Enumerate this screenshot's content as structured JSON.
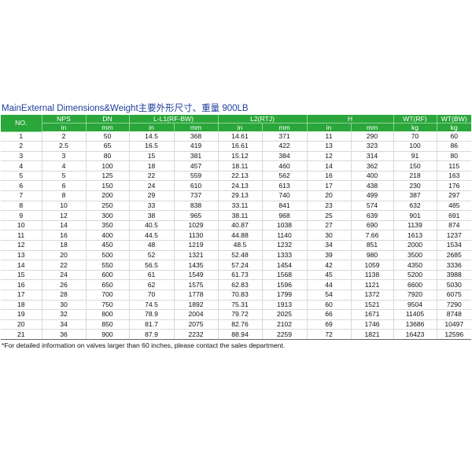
{
  "title": "MainExternal Dimensions&Weight主要外形尺寸、重量   900LB",
  "header": {
    "no": "NO.",
    "nps": "NPS",
    "dn": "DN",
    "l_rf_bw": "L-L1(RF-BW)",
    "l2_rtj": "L2(RTJ)",
    "h": "H",
    "wt_rf": "WT(RF)",
    "wt_bw": "WT(BW)",
    "units": [
      "in",
      "mm",
      "in",
      "mm",
      "in",
      "mm",
      "in",
      "mm",
      "kg",
      "kg"
    ]
  },
  "rows": [
    [
      "1",
      "2",
      "50",
      "14.5",
      "368",
      "14.61",
      "371",
      "11",
      "290",
      "70",
      "60"
    ],
    [
      "2",
      "2.5",
      "65",
      "16.5",
      "419",
      "16.61",
      "422",
      "13",
      "323",
      "100",
      "86"
    ],
    [
      "3",
      "3",
      "80",
      "15",
      "381",
      "15.12",
      "384",
      "12",
      "314",
      "91",
      "80"
    ],
    [
      "4",
      "4",
      "100",
      "18",
      "457",
      "18.11",
      "460",
      "14",
      "362",
      "150",
      "115"
    ],
    [
      "5",
      "5",
      "125",
      "22",
      "559",
      "22.13",
      "562",
      "16",
      "400",
      "218",
      "163"
    ],
    [
      "6",
      "6",
      "150",
      "24",
      "610",
      "24.13",
      "613",
      "17",
      "438",
      "230",
      "176"
    ],
    [
      "7",
      "8",
      "200",
      "29",
      "737",
      "29.13",
      "740",
      "20",
      "499",
      "387",
      "297"
    ],
    [
      "8",
      "10",
      "250",
      "33",
      "838",
      "33.11",
      "841",
      "23",
      "574",
      "632",
      "485"
    ],
    [
      "9",
      "12",
      "300",
      "38",
      "965",
      "38.11",
      "968",
      "25",
      "639",
      "901",
      "691"
    ],
    [
      "10",
      "14",
      "350",
      "40.5",
      "1029",
      "40.87",
      "1038",
      "27",
      "690",
      "1139",
      "874"
    ],
    [
      "11",
      "16",
      "400",
      "44.5",
      "1130",
      "44.88",
      "1140",
      "30",
      "7.66",
      "1613",
      "1237"
    ],
    [
      "12",
      "18",
      "450",
      "48",
      "1219",
      "48.5",
      "1232",
      "34",
      "851",
      "2000",
      "1534"
    ],
    [
      "13",
      "20",
      "500",
      "52",
      "1321",
      "52.48",
      "1333",
      "39",
      "980",
      "3500",
      "2685"
    ],
    [
      "14",
      "22",
      "550",
      "56.5",
      "1435",
      "57.24",
      "1454",
      "42",
      "1059",
      "4350",
      "3336"
    ],
    [
      "15",
      "24",
      "600",
      "61",
      "1549",
      "61.73",
      "1568",
      "45",
      "1138",
      "5200",
      "3988"
    ],
    [
      "16",
      "26",
      "650",
      "62",
      "1575",
      "62.83",
      "1596",
      "44",
      "1121",
      "6600",
      "5030"
    ],
    [
      "17",
      "28",
      "700",
      "70",
      "1778",
      "70.83",
      "1799",
      "54",
      "1372",
      "7920",
      "6075"
    ],
    [
      "18",
      "30",
      "750",
      "74.5",
      "1892",
      "75.31",
      "1913",
      "60",
      "1521",
      "9504",
      "7290"
    ],
    [
      "19",
      "32",
      "800",
      "78.9",
      "2004",
      "79.72",
      "2025",
      "66",
      "1671",
      "11405",
      "8748"
    ],
    [
      "20",
      "34",
      "850",
      "81.7",
      "2075",
      "82.76",
      "2102",
      "69",
      "1746",
      "13686",
      "10497"
    ],
    [
      "21",
      "36",
      "900",
      "87.9",
      "2232",
      "88.94",
      "2259",
      "72",
      "1821",
      "16423",
      "12596"
    ]
  ],
  "note": "*For detailed information on valves larger than 60 inches, please contact the sales department."
}
